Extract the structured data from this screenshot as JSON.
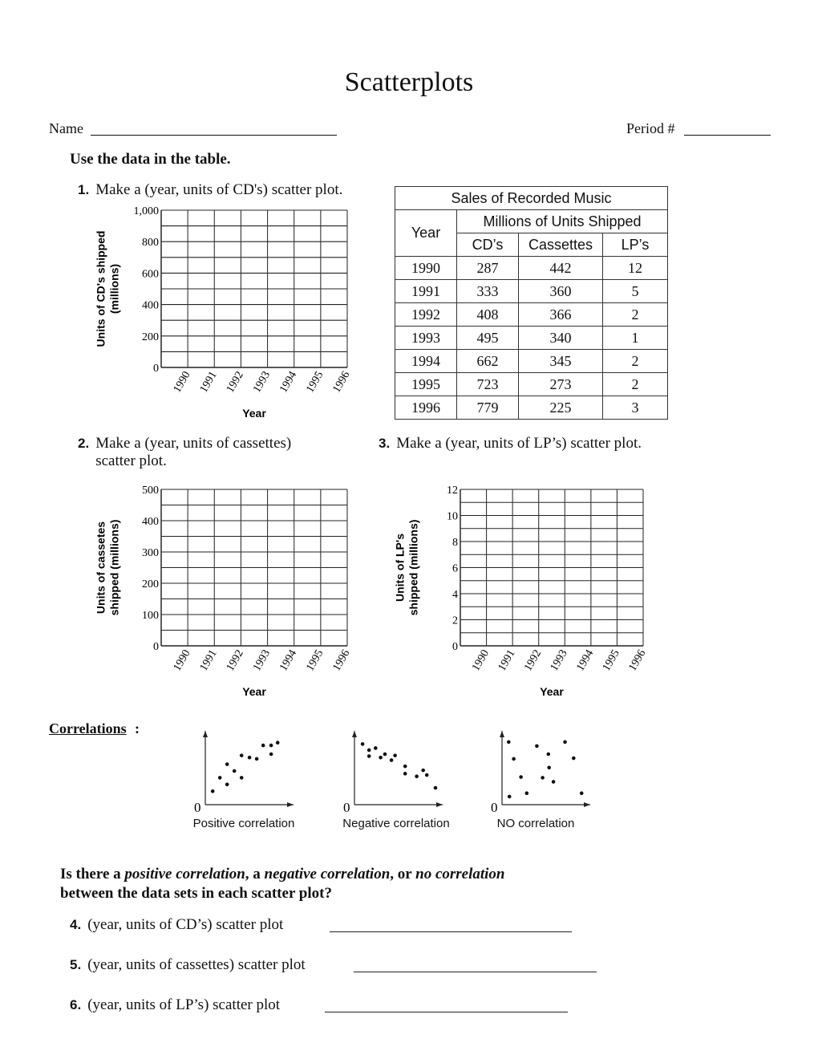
{
  "header": {
    "title": "Scatterplots",
    "name_label": "Name",
    "period_label": "Period #"
  },
  "instructions": "Use the data in the table.",
  "questions": {
    "q1": {
      "number": "1.",
      "text": "Make a (year, units of CD's) scatter plot."
    },
    "q2": {
      "number": "2.",
      "text": "Make a (year, units of cassettes) scatter plot."
    },
    "q3": {
      "number": "3.",
      "text": "Make a (year, units of LP’s) scatter plot."
    }
  },
  "table": {
    "title": "Sales of Recorded Music",
    "year_header": "Year",
    "group_header": "Millions of Units Shipped",
    "columns": [
      "CD’s",
      "Cassettes",
      "LP’s"
    ],
    "rows": [
      {
        "year": "1990",
        "cds": "287",
        "cassettes": "442",
        "lps": "12"
      },
      {
        "year": "1991",
        "cds": "333",
        "cassettes": "360",
        "lps": "5"
      },
      {
        "year": "1992",
        "cds": "408",
        "cassettes": "366",
        "lps": "2"
      },
      {
        "year": "1993",
        "cds": "495",
        "cassettes": "340",
        "lps": "1"
      },
      {
        "year": "1994",
        "cds": "662",
        "cassettes": "345",
        "lps": "2"
      },
      {
        "year": "1995",
        "cds": "723",
        "cassettes": "273",
        "lps": "2"
      },
      {
        "year": "1996",
        "cds": "779",
        "cassettes": "225",
        "lps": "3"
      }
    ]
  },
  "chart_data": [
    {
      "id": "cd-plot",
      "type": "scatter",
      "title": "",
      "xlabel": "Year",
      "ylabel_lines": [
        "Units of CD's shipped",
        "(millions)"
      ],
      "x_ticks": [
        "1990",
        "1991",
        "1992",
        "1993",
        "1994",
        "1995",
        "1996"
      ],
      "y_ticks": [
        "0",
        "200",
        "400",
        "600",
        "800",
        "1,000"
      ],
      "ylim": [
        0,
        1000
      ],
      "grid": true,
      "grid_rows": 10,
      "grid_cols": 7,
      "points": []
    },
    {
      "id": "cassette-plot",
      "type": "scatter",
      "title": "",
      "xlabel": "Year",
      "ylabel_lines": [
        "Units of cassetes",
        "shipped (millions)"
      ],
      "x_ticks": [
        "1990",
        "1991",
        "1992",
        "1993",
        "1994",
        "1995",
        "1996"
      ],
      "y_ticks": [
        "0",
        "100",
        "200",
        "300",
        "400",
        "500"
      ],
      "ylim": [
        0,
        500
      ],
      "grid": true,
      "grid_rows": 10,
      "grid_cols": 7,
      "points": []
    },
    {
      "id": "lp-plot",
      "type": "scatter",
      "title": "",
      "xlabel": "Year",
      "ylabel_lines": [
        "Units of LP's",
        "shipped (millions)"
      ],
      "x_ticks": [
        "1990",
        "1991",
        "1992",
        "1993",
        "1994",
        "1995",
        "1996"
      ],
      "y_ticks": [
        "0",
        "2",
        "4",
        "6",
        "8",
        "10",
        "12"
      ],
      "ylim": [
        0,
        12
      ],
      "grid": true,
      "grid_rows": 12,
      "grid_cols": 7,
      "points": []
    },
    {
      "id": "positive-example",
      "type": "scatter",
      "title": "Positive correlation",
      "origin_label": "0",
      "xlim": [
        0,
        10
      ],
      "ylim": [
        0,
        10
      ],
      "points": [
        [
          0.8,
          2
        ],
        [
          1.8,
          4
        ],
        [
          2.8,
          3
        ],
        [
          2.8,
          6
        ],
        [
          3.8,
          5
        ],
        [
          4.8,
          4
        ],
        [
          4.8,
          7.3
        ],
        [
          5.9,
          7
        ],
        [
          6.9,
          6.8
        ],
        [
          7.8,
          8.8
        ],
        [
          8.9,
          7.5
        ],
        [
          8.9,
          8.8
        ],
        [
          9.8,
          9.2
        ]
      ]
    },
    {
      "id": "negative-example",
      "type": "scatter",
      "title": "Negative correlation",
      "origin_label": "0",
      "xlim": [
        0,
        10
      ],
      "ylim": [
        0,
        10
      ],
      "points": [
        [
          0.9,
          9
        ],
        [
          1.8,
          8.1
        ],
        [
          1.8,
          7.2
        ],
        [
          2.7,
          8.4
        ],
        [
          3.4,
          7
        ],
        [
          4,
          7.5
        ],
        [
          4.9,
          6.6
        ],
        [
          5.4,
          7.3
        ],
        [
          6.8,
          4.6
        ],
        [
          6.8,
          5.7
        ],
        [
          8.4,
          4.2
        ],
        [
          9.3,
          5.1
        ],
        [
          9.8,
          4.4
        ],
        [
          11,
          2.5
        ]
      ]
    },
    {
      "id": "no-correlation-example",
      "type": "scatter",
      "title": "NO correlation",
      "origin_label": "0",
      "xlim": [
        0,
        10
      ],
      "ylim": [
        0,
        10
      ],
      "points": [
        [
          0.7,
          9.3
        ],
        [
          1.4,
          6.8
        ],
        [
          2.4,
          4.1
        ],
        [
          3.2,
          1.7
        ],
        [
          4.6,
          8.7
        ],
        [
          5.4,
          4
        ],
        [
          6.2,
          7.5
        ],
        [
          6.3,
          5.5
        ],
        [
          6.9,
          3.4
        ],
        [
          8.5,
          9.3
        ],
        [
          9.7,
          6.9
        ],
        [
          10.8,
          1.7
        ],
        [
          0.8,
          1.2
        ]
      ]
    }
  ],
  "correlations": {
    "label": "Correlations",
    "colon": ":"
  },
  "prompt": {
    "part1": "Is there a ",
    "positive": "positive correlation",
    "part2": ", a ",
    "negative": "negative correlation",
    "part3": ", or ",
    "none": "no correlation",
    "part4": "between the data sets in each scatter plot?"
  },
  "answers": [
    {
      "number": "4.",
      "text": "(year, units of CD’s) scatter plot",
      "value": ""
    },
    {
      "number": "5.",
      "text": "(year, units of cassettes) scatter plot",
      "value": ""
    },
    {
      "number": "6.",
      "text": "(year, units of LP’s) scatter plot",
      "value": ""
    }
  ]
}
